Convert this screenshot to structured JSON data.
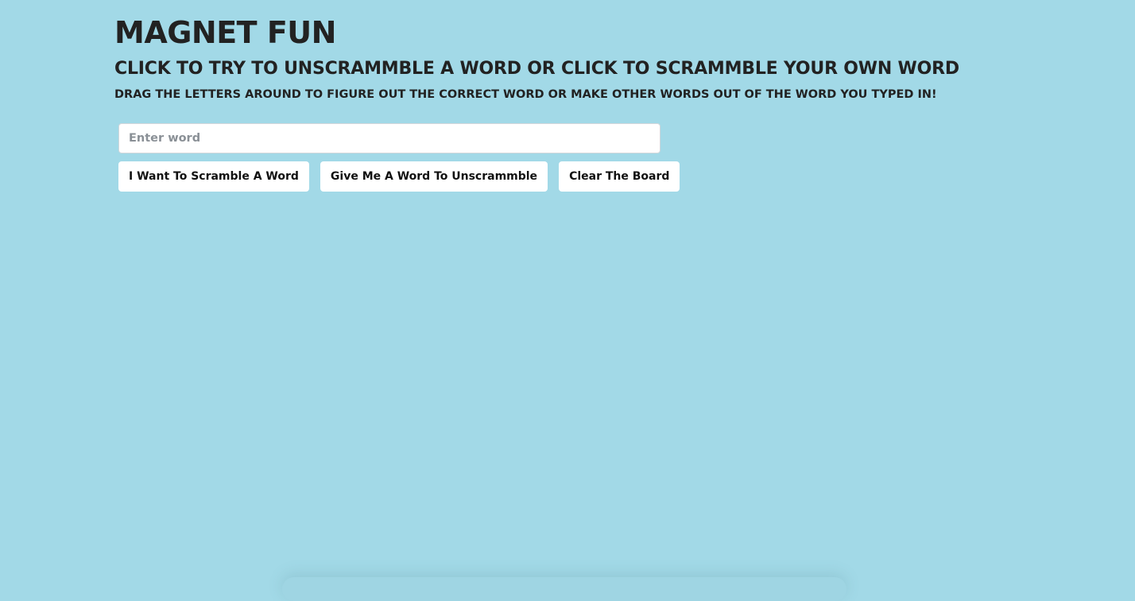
{
  "header": {
    "title": "MAGNET FUN",
    "subtitle": "CLICK TO TRY TO UNSCRAMMBLE A WORD OR CLICK TO SCRAMMBLE YOUR OWN WORD",
    "instructions": "DRAG THE LETTERS AROUND TO FIGURE OUT THE CORRECT WORD OR MAKE OTHER WORDS OUT OF THE WORD YOU TYPED IN!"
  },
  "word_input": {
    "placeholder": "Enter word",
    "value": ""
  },
  "buttons": {
    "scramble_label": "I Want To Scramble A Word",
    "unscramble_label": "Give Me A Word To Unscrammble",
    "clear_label": "Clear The Board"
  },
  "colors": {
    "background": "#a2d9e7",
    "button_bg": "#ffffff",
    "text": "#222222"
  }
}
